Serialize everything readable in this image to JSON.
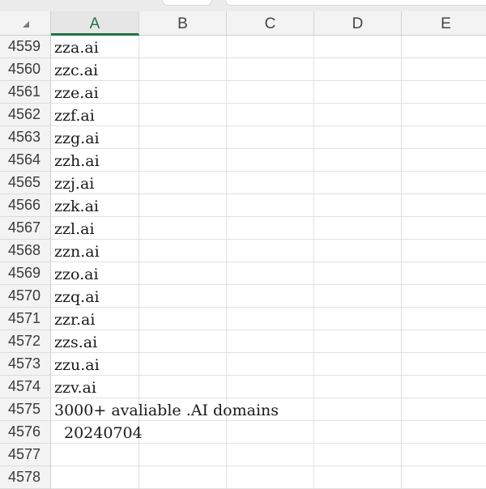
{
  "columns": [
    "A",
    "B",
    "C",
    "D",
    "E"
  ],
  "selected_column": "A",
  "rows": [
    {
      "num": "4559",
      "a": "zza.ai"
    },
    {
      "num": "4560",
      "a": "zzc.ai"
    },
    {
      "num": "4561",
      "a": "zze.ai"
    },
    {
      "num": "4562",
      "a": "zzf.ai"
    },
    {
      "num": "4563",
      "a": "zzg.ai"
    },
    {
      "num": "4564",
      "a": "zzh.ai"
    },
    {
      "num": "4565",
      "a": "zzj.ai"
    },
    {
      "num": "4566",
      "a": "zzk.ai"
    },
    {
      "num": "4567",
      "a": "zzl.ai"
    },
    {
      "num": "4568",
      "a": "zzn.ai"
    },
    {
      "num": "4569",
      "a": "zzo.ai"
    },
    {
      "num": "4570",
      "a": "zzq.ai"
    },
    {
      "num": "4571",
      "a": "zzr.ai"
    },
    {
      "num": "4572",
      "a": "zzs.ai"
    },
    {
      "num": "4573",
      "a": "zzu.ai"
    },
    {
      "num": "4574",
      "a": "zzv.ai"
    },
    {
      "num": "4575",
      "a": "3000+ avaliable .AI domains"
    },
    {
      "num": "4576",
      "a": "20240704"
    },
    {
      "num": "4577",
      "a": ""
    },
    {
      "num": "4578",
      "a": ""
    }
  ],
  "colors": {
    "accent": "#217346",
    "header_bg": "#f3f3f3",
    "gridline": "#e1e1e1"
  }
}
